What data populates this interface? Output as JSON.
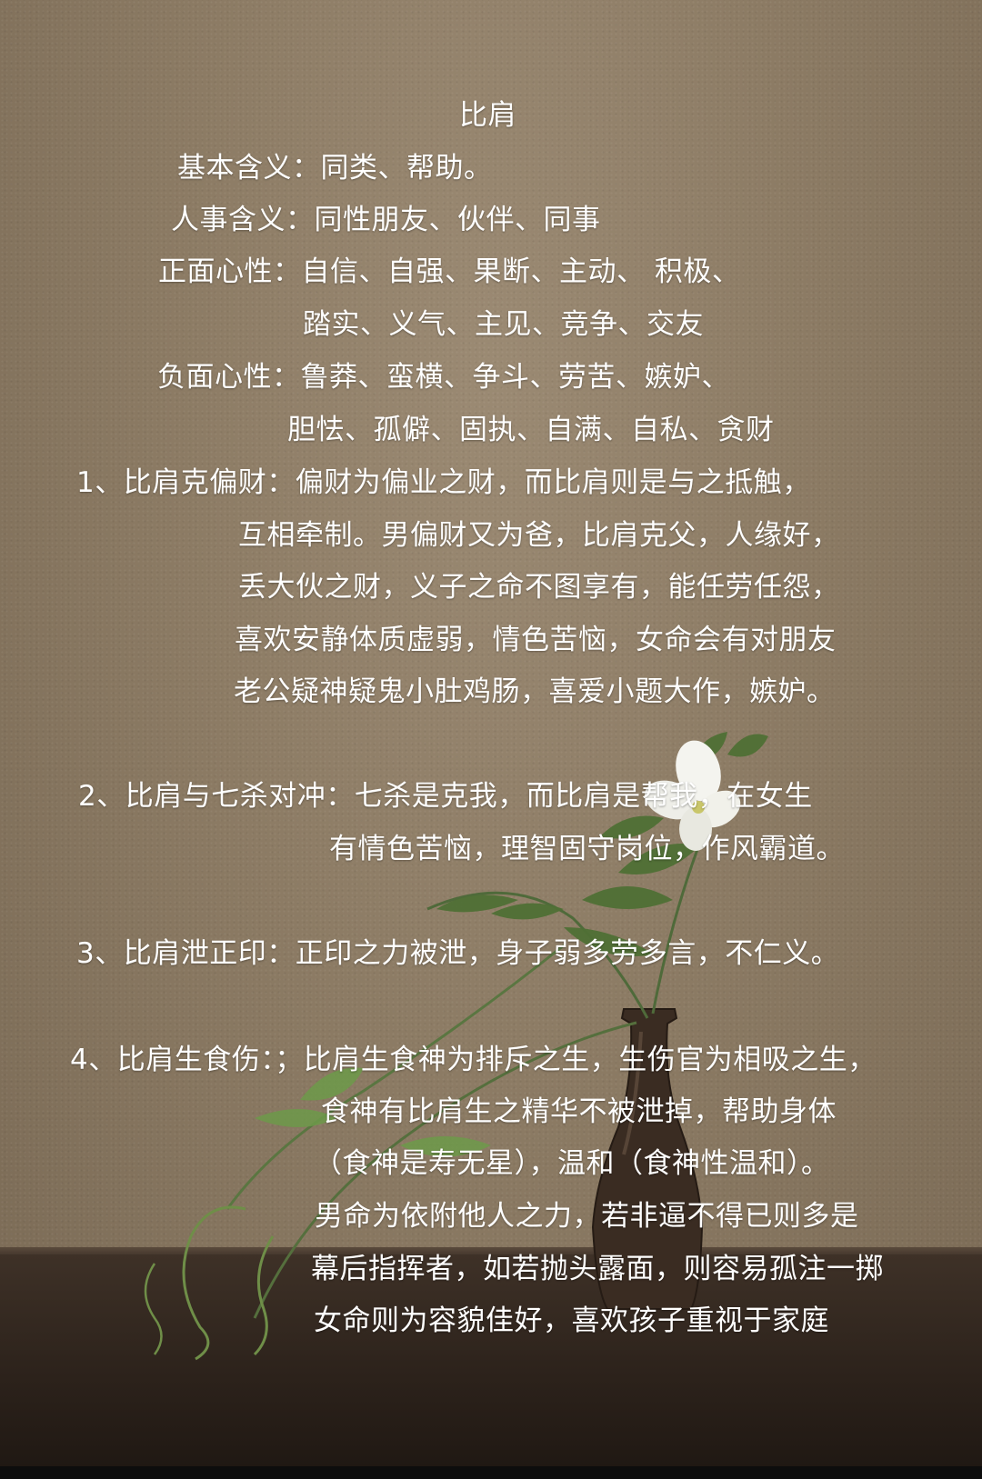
{
  "title": "比肩",
  "lines": [
    "基本含义：同类、帮助。",
    "人事含义：同性朋友、伙伴、同事",
    "正面心性：自信、自强、果断、主动、 积极、",
    "踏实、义气、主见、竞争、交友",
    "负面心性：鲁莽、蛮横、争斗、劳苦、嫉妒、",
    "胆怯、孤僻、固执、自满、自私、贪财",
    "1、比肩克偏财：偏财为偏业之财，而比肩则是与之抵触，",
    "互相牵制。男偏财又为爸，比肩克父，人缘好，",
    "丢大伙之财，义子之命不图享有，能任劳任怨，",
    "喜欢安静体质虚弱，情色苦恼，女命会有对朋友",
    "老公疑神疑鬼小肚鸡肠，喜爱小题大作，嫉妒。",
    "2、比肩与七杀对冲：七杀是克我，而比肩是帮我，在女生",
    "有情色苦恼，理智固守岗位，作风霸道。",
    "3、比肩泄正印：正印之力被泄，身子弱多劳多言，不仁义。",
    "4、比肩生食伤：；比肩生食神为排斥之生，生伤官为相吸之生，",
    "食神有比肩生之精华不被泄掉，帮助身体",
    "（食神是寿无星），温和（食神性温和）。",
    "男命为依附他人之力，若非逼不得已则多是",
    "幕后指挥者，如若抛头露面，则容易孤注一掷",
    "女命则为容貌佳好，喜欢孩子重视于家庭"
  ]
}
